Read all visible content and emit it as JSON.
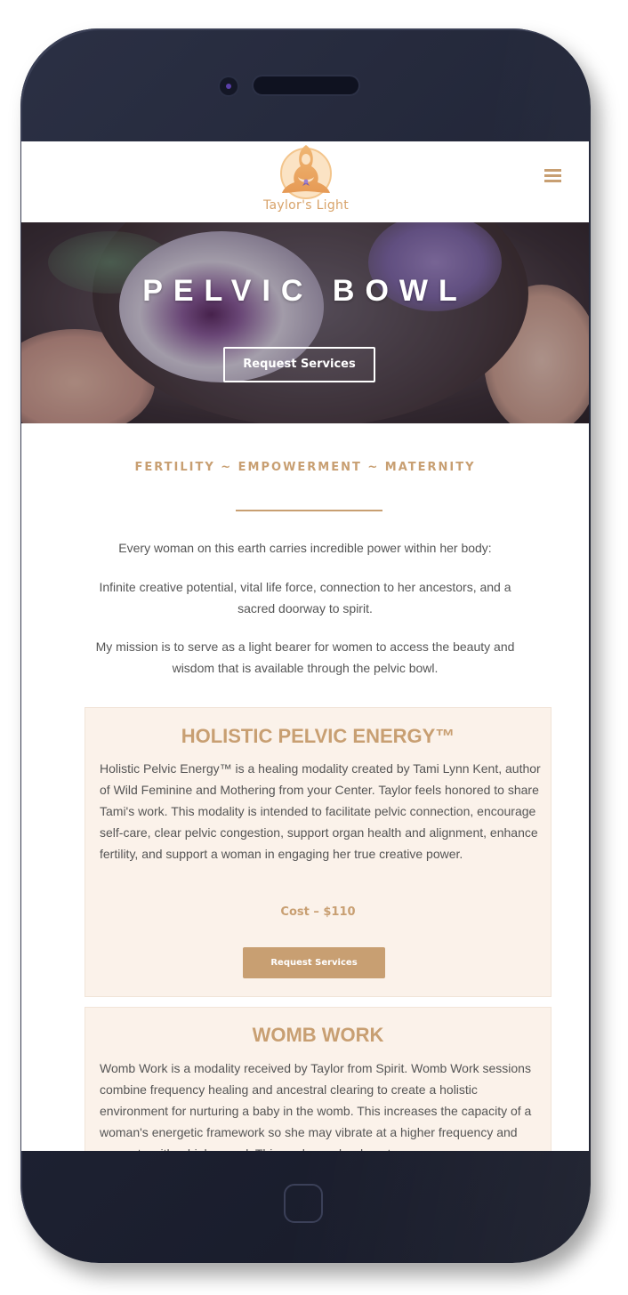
{
  "site": {
    "logo_text": "Taylor's Light",
    "menu_icon": "hamburger-icon"
  },
  "hero": {
    "title": "PELVIC BOWL",
    "button_label": "Request Services"
  },
  "intro": {
    "tagline": "FERTILITY ~ EMPOWERMENT ~ MATERNITY",
    "paragraphs": [
      "Every woman on this earth carries incredible power within her body:",
      "Infinite creative potential, vital life force, connection to her ancestors, and a sacred doorway to spirit.",
      "My mission is to serve as a light bearer for women to access the beauty and wisdom that is available through the pelvic bowl."
    ]
  },
  "services": [
    {
      "title": "HOLISTIC PELVIC ENERGY™",
      "body": "Holistic Pelvic Energy™ is a healing modality created by Tami Lynn Kent, author of Wild Feminine and Mothering from your Center. Taylor feels honored to share Tami's work. This modality is intended to facilitate pelvic connection, encourage self-care, clear pelvic congestion, support organ health and alignment, enhance fertility, and support a woman in engaging her true creative power.",
      "cost": "Cost – $110",
      "button_label": "Request Services"
    },
    {
      "title": "WOMB WORK",
      "body": "Womb Work is a modality received by Taylor from Spirit. Womb Work sessions combine frequency healing and ancestral clearing to create a holistic environment for nurturing a baby in the womb. This increases the capacity of a woman's energetic framework so she may vibrate at a higher frequency and resonate with a higher soul. This work may be done to"
    }
  ],
  "colors": {
    "accent": "#c89f72",
    "card_background": "#fbf2ea",
    "body_text": "#555555",
    "phone_frame": "#1e2233"
  }
}
